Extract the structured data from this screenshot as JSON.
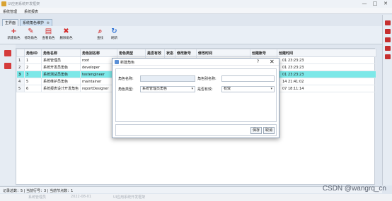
{
  "window": {
    "title": "UI应用系统开发框架",
    "controls": [
      "—",
      "□",
      "✕"
    ]
  },
  "menu": {
    "items": [
      "系统管理",
      "系统报表"
    ]
  },
  "tabs": [
    {
      "label": "主界面"
    },
    {
      "label": "系统角色维护"
    }
  ],
  "tab_close": "⊗",
  "toolbar": {
    "buttons": [
      {
        "label": "新建角色",
        "icon": "+",
        "color": "#d42b2b"
      },
      {
        "label": "修改角色",
        "icon": "✎",
        "color": "#d42b2b"
      },
      {
        "label": "查看角色",
        "icon": "▤",
        "color": "#d42b2b"
      },
      {
        "label": "删除角色",
        "icon": "✖",
        "color": "#d42b2b"
      },
      {
        "label": "查找",
        "icon": "⌕",
        "color": "#d42b2b"
      },
      {
        "label": "刷新",
        "icon": "↻",
        "color": "#2b6fd4"
      }
    ]
  },
  "grid": {
    "columns": [
      "",
      "角色ID",
      "角色名称",
      "角色别名称",
      "角色类型",
      "是否有效",
      "状态",
      "修改账号",
      "修改时间",
      "创建账号",
      "创建时间"
    ],
    "rows": [
      {
        "no": "1",
        "id": "1",
        "name": "系统管理员",
        "alias": "root",
        "time_tail": "01 23:23:23",
        "selected": false
      },
      {
        "no": "2",
        "id": "2",
        "name": "系统开发员角色",
        "alias": "developer",
        "time_tail": "01 23:23:23",
        "selected": false
      },
      {
        "no": "3",
        "id": "3",
        "name": "系统测试员角色",
        "alias": "testengineer",
        "time_tail": "01 23:23:23",
        "selected": true
      },
      {
        "no": "4",
        "id": "5",
        "name": "系统维护员角色",
        "alias": "maintainer",
        "time_tail": "14 21:41:02",
        "selected": false
      },
      {
        "no": "5",
        "id": "6",
        "name": "系统报表设计开发角色",
        "alias": "reportDesigner",
        "time_tail": "07 18:11:14",
        "selected": false
      }
    ]
  },
  "status": {
    "text": "记录总数：5 | 当前行号：3 | 当前节点数：1"
  },
  "dialog": {
    "title": "新建角色",
    "help": "?",
    "close": "✕",
    "fields": {
      "role_name_label": "角色名称:",
      "role_name_value": "",
      "role_alias_label": "角色别名称:",
      "role_alias_value": "",
      "role_type_label": "角色类型:",
      "role_type_value": "系统管理员角色",
      "valid_label": "是否有效:",
      "valid_value": "有效"
    },
    "save_label": "保存",
    "cancel_label": "取消"
  },
  "watermark": "CSDN @wangrq_cn",
  "bottom_bar": [
    "系统管理员",
    "2022-08-01",
    "UI应用系统开发框架"
  ]
}
